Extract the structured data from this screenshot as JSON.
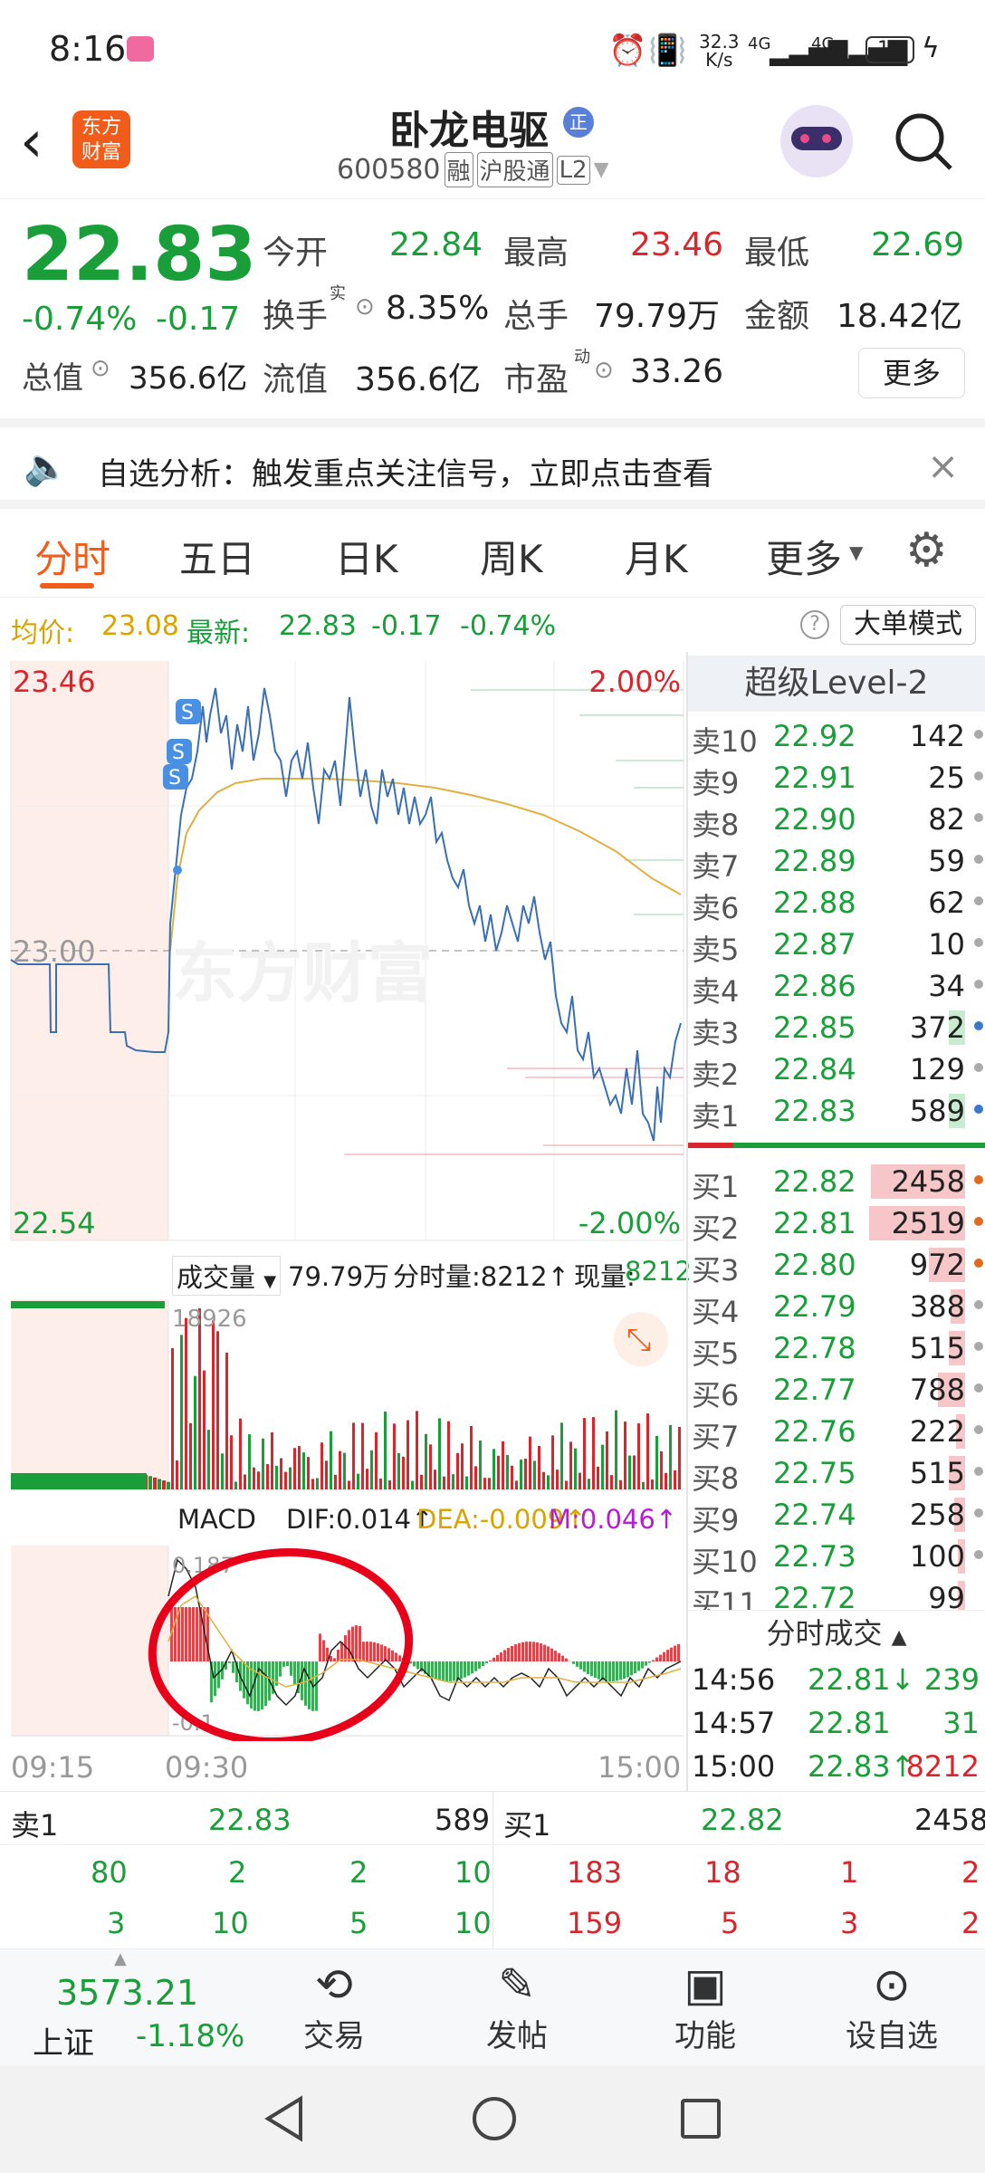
{
  "status": {
    "time": "8:16",
    "net_speed_top": "32.3",
    "net_speed_unit": "K/s",
    "sig1": "4G",
    "sig2": "4G",
    "battery": "14"
  },
  "header": {
    "stock_name": "卧龙电驱",
    "badge": "正",
    "code": "600580",
    "tags": [
      "融",
      "沪股通",
      "L2"
    ],
    "logo_line1": "东方",
    "logo_line2": "财富"
  },
  "quote": {
    "price": "22.83",
    "change_pct": "-0.74%",
    "change": "-0.17",
    "open_label": "今开",
    "open": "22.84",
    "high_label": "最高",
    "high": "23.46",
    "low_label": "最低",
    "low": "22.69",
    "turnover_label": "换手",
    "turnover_sup": "实",
    "turnover": "8.35%",
    "volume_label": "总手",
    "volume": "79.79万",
    "amount_label": "金额",
    "amount": "18.42亿",
    "mcap_label": "总值",
    "mcap": "356.6亿",
    "float_label": "流值",
    "float": "356.6亿",
    "pe_label": "市盈",
    "pe_sup": "动",
    "pe": "33.26",
    "more_button": "更多"
  },
  "banner": {
    "text": "自选分析：触发重点关注信号，立即点击查看"
  },
  "tabs": [
    "分时",
    "五日",
    "日K",
    "周K",
    "月K",
    "更多"
  ],
  "infobar": {
    "avg_label": "均价:",
    "avg": "23.08",
    "latest_label": "最新:",
    "latest": "22.83",
    "chg": "-0.17",
    "pct": "-0.74%",
    "mode_button": "大单模式"
  },
  "chart": {
    "y_top": "23.46",
    "y_mid": "23.00",
    "y_bot": "22.54",
    "pct_top": "2.00%",
    "pct_bot": "-2.00%",
    "watermark": "东方财富",
    "signal": "S"
  },
  "volume": {
    "selector": "成交量",
    "total": "79.79万",
    "tick_label": "分时量:8212↑",
    "now_label": "现量:",
    "now": "8212",
    "peak": "18926"
  },
  "macd": {
    "title": "MACD",
    "dif": "DIF:0.014↑",
    "dea": "DEA:-0.009↑",
    "m": "M:0.046↑",
    "top": "0.187",
    "bot": "-0.1"
  },
  "time_axis": [
    "09:15",
    "09:30",
    "15:00"
  ],
  "orderbook": {
    "title": "超级Level-2",
    "asks": [
      {
        "label": "卖10",
        "price": "22.92",
        "vol": "142"
      },
      {
        "label": "卖9",
        "price": "22.91",
        "vol": "25"
      },
      {
        "label": "卖8",
        "price": "22.90",
        "vol": "82"
      },
      {
        "label": "卖7",
        "price": "22.89",
        "vol": "59"
      },
      {
        "label": "卖6",
        "price": "22.88",
        "vol": "62"
      },
      {
        "label": "卖5",
        "price": "22.87",
        "vol": "10"
      },
      {
        "label": "卖4",
        "price": "22.86",
        "vol": "34"
      },
      {
        "label": "卖3",
        "price": "22.85",
        "vol": "372"
      },
      {
        "label": "卖2",
        "price": "22.84",
        "vol": "129"
      },
      {
        "label": "卖1",
        "price": "22.83",
        "vol": "589"
      }
    ],
    "bids": [
      {
        "label": "买1",
        "price": "22.82",
        "vol": "2458"
      },
      {
        "label": "买2",
        "price": "22.81",
        "vol": "2519"
      },
      {
        "label": "买3",
        "price": "22.80",
        "vol": "972"
      },
      {
        "label": "买4",
        "price": "22.79",
        "vol": "388"
      },
      {
        "label": "买5",
        "price": "22.78",
        "vol": "515"
      },
      {
        "label": "买6",
        "price": "22.77",
        "vol": "788"
      },
      {
        "label": "买7",
        "price": "22.76",
        "vol": "222"
      },
      {
        "label": "买8",
        "price": "22.75",
        "vol": "515"
      },
      {
        "label": "买9",
        "price": "22.74",
        "vol": "258"
      },
      {
        "label": "买10",
        "price": "22.73",
        "vol": "100"
      },
      {
        "label": "买11",
        "price": "22.72",
        "vol": "99"
      }
    ],
    "trades_title": "分时成交",
    "trades": [
      {
        "time": "14:56",
        "price": "22.81↓",
        "vol": "239"
      },
      {
        "time": "14:57",
        "price": "22.81",
        "vol": "31"
      },
      {
        "time": "15:00",
        "price": "22.83↑",
        "vol": "8212"
      }
    ]
  },
  "level": {
    "ask_label": "卖1",
    "ask_price": "22.83",
    "ask_vol": "589",
    "bid_label": "买1",
    "bid_price": "22.82",
    "bid_vol": "2458",
    "ask_q1": [
      "80",
      "2",
      "2",
      "10"
    ],
    "ask_q2": [
      "3",
      "10",
      "5",
      "10"
    ],
    "bid_q1": [
      "183",
      "18",
      "1",
      "2"
    ],
    "bid_q2": [
      "159",
      "5",
      "3",
      "2"
    ]
  },
  "nav": {
    "index_value": "3573.21",
    "index_name": "上证",
    "index_pct": "-1.18%",
    "items": [
      "交易",
      "发帖",
      "功能",
      "设自选"
    ]
  }
}
